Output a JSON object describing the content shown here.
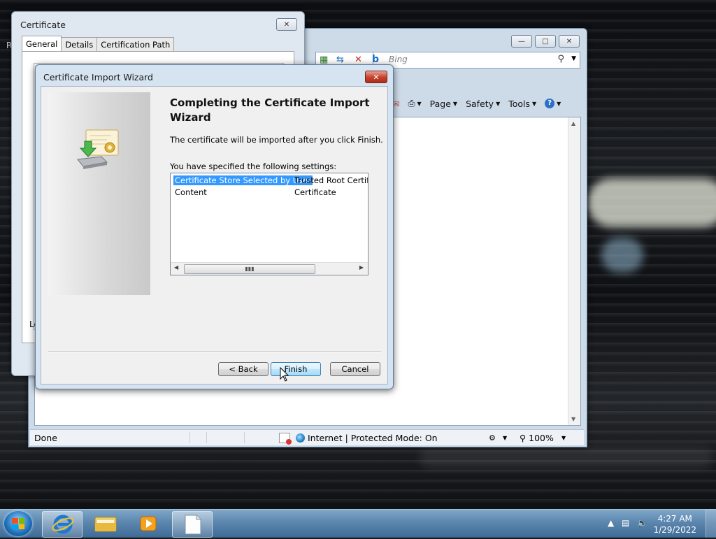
{
  "ie": {
    "search_placeholder": "Bing",
    "commands": [
      {
        "label": "Page"
      },
      {
        "label": "Safety"
      },
      {
        "label": "Tools"
      }
    ],
    "status": {
      "text": "Done",
      "zone": "Internet | Protected Mode: On",
      "zoom": "100%"
    }
  },
  "cert_dialog": {
    "title": "Certificate",
    "tabs": [
      "General",
      "Details",
      "Certification Path"
    ],
    "partial_text": "Le",
    "partial_left": "R"
  },
  "wizard": {
    "title": "Certificate Import Wizard",
    "heading": "Completing the Certificate Import Wizard",
    "description": "The certificate will be imported after you click Finish.",
    "settings_label": "You have specified the following settings:",
    "settings": [
      {
        "name": "Certificate Store Selected by User",
        "value": "Trusted Root Certifica"
      },
      {
        "name": "Content",
        "value": "Certificate"
      }
    ],
    "buttons": {
      "back": "< Back",
      "finish": "Finish",
      "cancel": "Cancel"
    }
  },
  "taskbar": {
    "time": "4:27 AM",
    "date": "1/29/2022"
  }
}
